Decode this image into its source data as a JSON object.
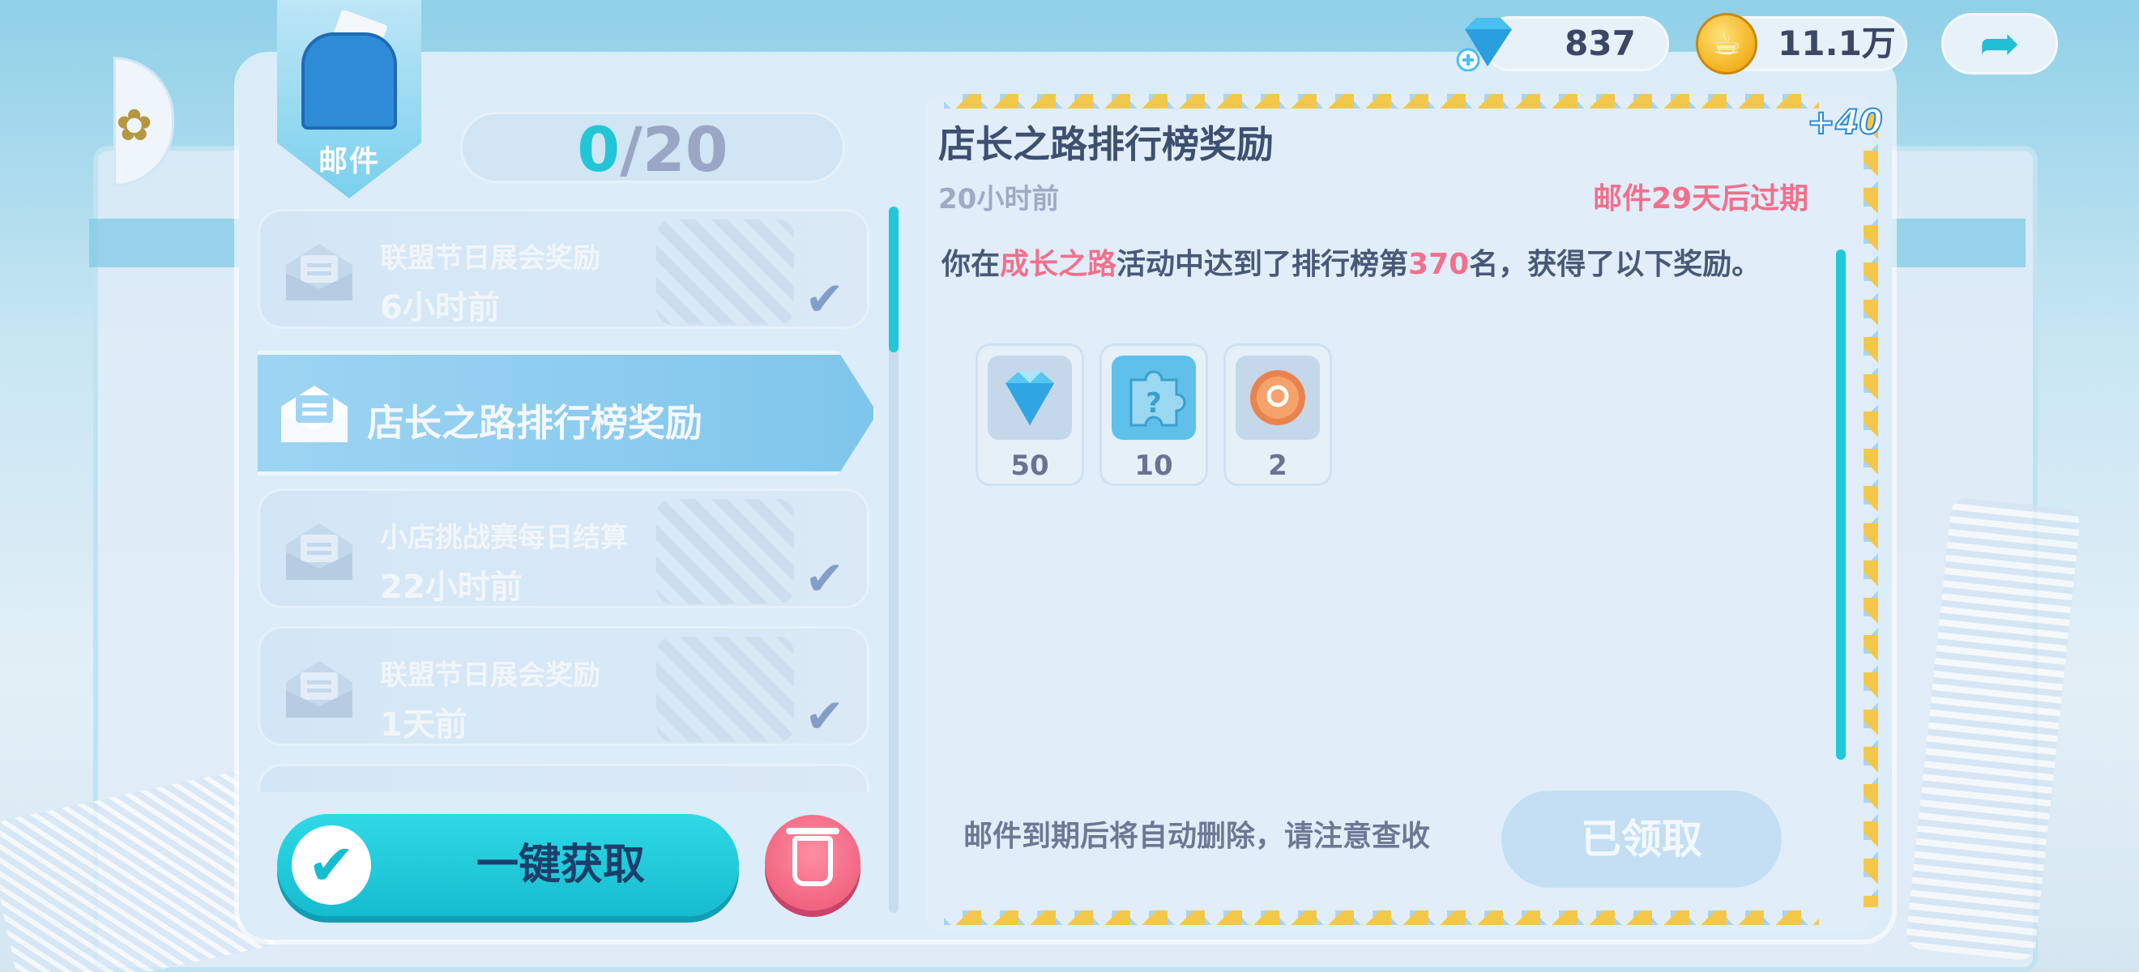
{
  "header": {
    "mail_label": "邮件",
    "counter_current": "0",
    "counter_total": "/20",
    "gems": "837",
    "coins": "11.1万"
  },
  "mail_list": [
    {
      "title": "联盟节日展会奖励",
      "time": "6小时前",
      "claimed": true
    },
    {
      "title": "店长之路排行榜奖励",
      "time": "",
      "selected": true
    },
    {
      "title": "小店挑战赛每日结算",
      "time": "22小时前",
      "claimed": true
    },
    {
      "title": "联盟节日展会奖励",
      "time": "1天前",
      "claimed": true
    }
  ],
  "buttons": {
    "collect_all": "一键获取",
    "claimed": "已领取"
  },
  "detail": {
    "title": "店长之路排行榜奖励",
    "time": "20小时前",
    "expire_prefix": "邮件",
    "expire_days": "29",
    "expire_suffix": "天后过期",
    "body_prefix": "你在",
    "body_event": "成长之路",
    "body_mid": "活动中达到了排行榜第",
    "body_rank": "370",
    "body_suffix": "名，获得了以下奖励。",
    "bonus": "+40",
    "note": "邮件到期后将自动删除，请注意查收",
    "rewards": [
      {
        "icon": "diamond-icon",
        "qty": "50"
      },
      {
        "icon": "puzzle-icon",
        "qty": "10"
      },
      {
        "icon": "coin-token-icon",
        "qty": "2"
      }
    ]
  },
  "colors": {
    "accent_cyan": "#1fc9d8",
    "highlight_pink": "#f2708c",
    "panel_bg": "#dcecf8"
  }
}
